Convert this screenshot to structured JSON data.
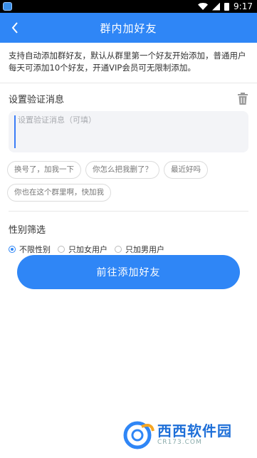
{
  "status_bar": {
    "time": "9:17",
    "icons": [
      "wifi-icon",
      "signal-icon",
      "battery-icon"
    ]
  },
  "header": {
    "title": "群内加好友",
    "back_icon": "chevron-left-icon"
  },
  "description": "支持自动添加群好友，默认从群里第一个好友开始添加，普通用户每天可添加10个好友，开通VIP会员可无限制添加。",
  "verify": {
    "title": "设置验证消息",
    "delete_icon": "trash-icon",
    "placeholder": "设置验证消息（可填）",
    "value": "",
    "suggestions": [
      "换号了，加我一下",
      "你怎么把我删了？",
      "最近好吗",
      "你也在这个群里啊，快加我"
    ]
  },
  "gender_filter": {
    "title": "性别筛选",
    "options": [
      {
        "label": "不限性别",
        "checked": true
      },
      {
        "label": "只加女用户",
        "checked": false
      },
      {
        "label": "只加男用户",
        "checked": false
      }
    ]
  },
  "submit_label": "前往添加好友",
  "watermark": {
    "main": "西西软件园",
    "sub": "CR173.COM"
  },
  "colors": {
    "primary": "#2f86f6",
    "background": "#ffffff",
    "input_bg": "#f3f4f7"
  }
}
